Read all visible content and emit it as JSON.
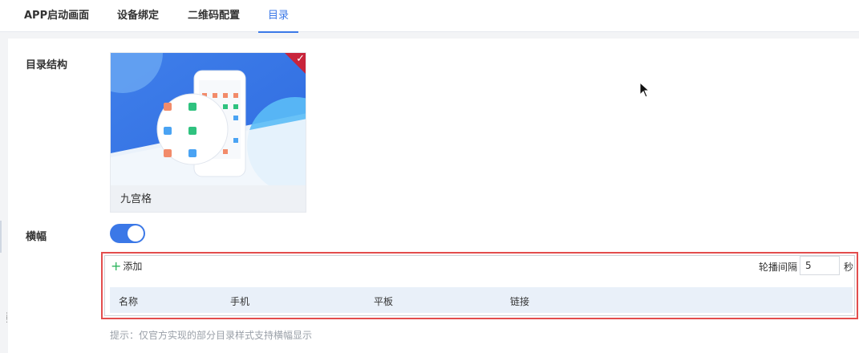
{
  "tabs": [
    {
      "label": "APP启动画面"
    },
    {
      "label": "设备绑定"
    },
    {
      "label": "二维码配置"
    },
    {
      "label": "目录",
      "active": true
    }
  ],
  "directory": {
    "label": "目录结构",
    "selected_card": {
      "caption": "九宫格",
      "selected": true
    }
  },
  "banner": {
    "label": "横幅",
    "enabled": true,
    "add_label": "添加",
    "interval_label": "轮播间隔",
    "interval_value": "5",
    "interval_unit": "秒",
    "columns": [
      "名称",
      "手机",
      "平板",
      "链接"
    ],
    "hint": "提示：仅官方实现的部分目录样式支持横幅显示"
  },
  "colors": {
    "accent": "#3b78e7",
    "highlight_border": "#e34d4d",
    "check_corner": "#c8243b",
    "add_icon": "#2db55d"
  }
}
